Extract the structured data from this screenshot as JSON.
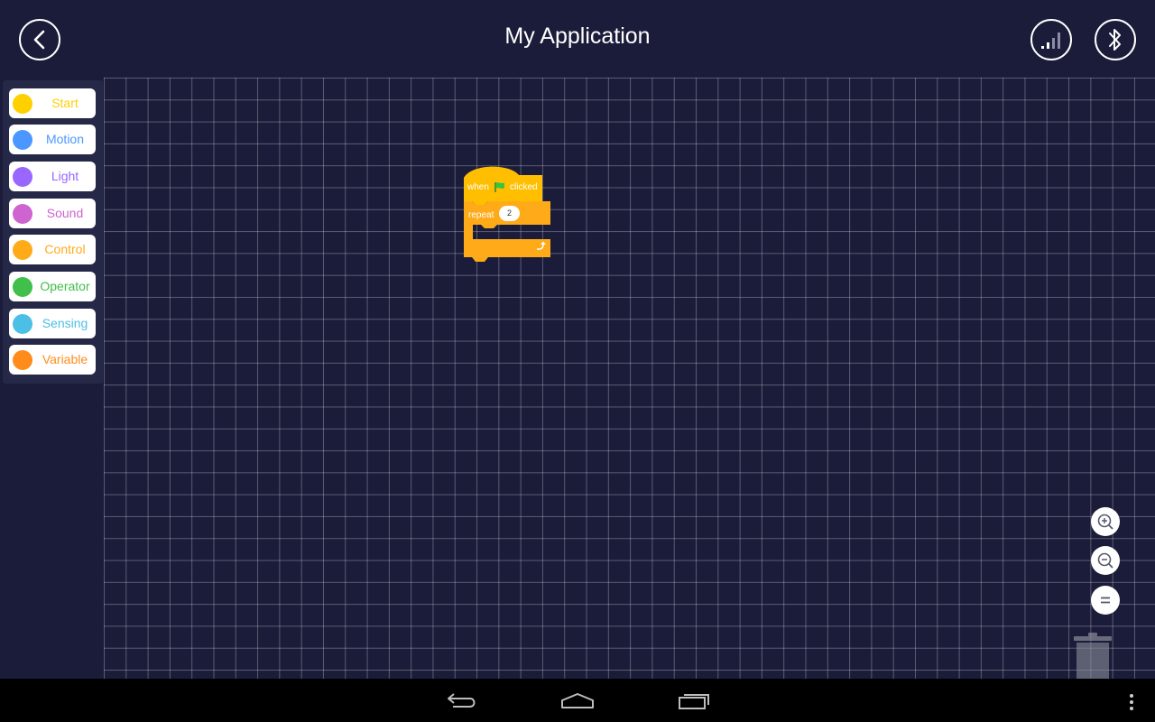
{
  "header": {
    "title": "My Application"
  },
  "palette": {
    "categories": [
      {
        "label": "Start",
        "color": "#ffd000"
      },
      {
        "label": "Motion",
        "color": "#4c97ff"
      },
      {
        "label": "Light",
        "color": "#9966ff"
      },
      {
        "label": "Sound",
        "color": "#cf63cf"
      },
      {
        "label": "Control",
        "color": "#ffab19"
      },
      {
        "label": "Operator",
        "color": "#40bf4a"
      },
      {
        "label": "Sensing",
        "color": "#4cbfe6"
      },
      {
        "label": "Variable",
        "color": "#ff8c1a"
      }
    ]
  },
  "script": {
    "hat_block": {
      "when": "when",
      "clicked": "clicked",
      "color": "#ffbf00",
      "icon": "green-flag-icon"
    },
    "repeat_block": {
      "label": "repeat",
      "count": "2",
      "color": "#ffab19",
      "icon": "loop-arrow-icon"
    }
  },
  "zoom": {
    "icons": [
      "zoom-in-icon",
      "zoom-out-icon",
      "zoom-reset-icon"
    ]
  },
  "colors": {
    "background": "#1b1c3a",
    "grid": "#ffffff",
    "palette_bg": "#262847"
  }
}
